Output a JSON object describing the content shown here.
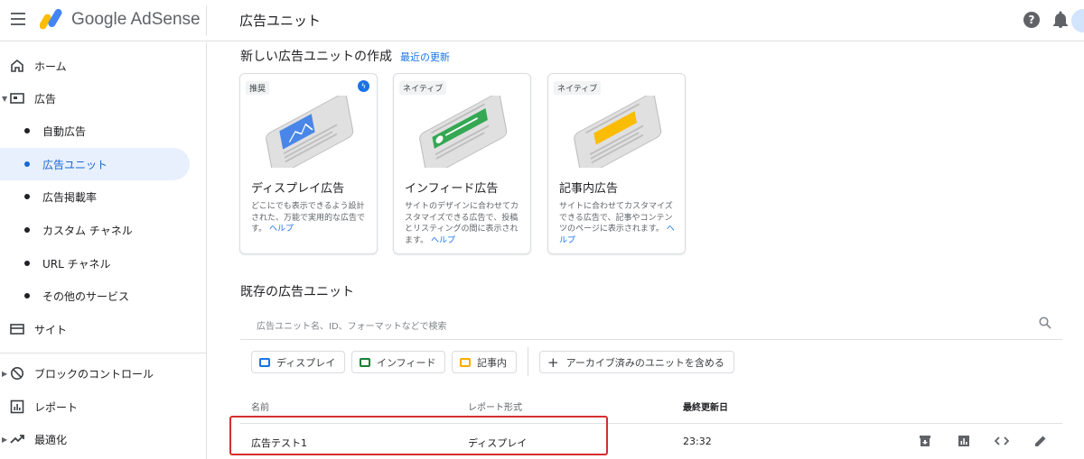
{
  "header": {
    "brand": "Google AdSense",
    "page_title": "広告ユニット",
    "help_glyph": "?"
  },
  "sidebar": {
    "items": [
      {
        "label": "ホーム",
        "icon": "home-icon"
      },
      {
        "label": "広告",
        "icon": "ads-icon"
      },
      {
        "label": "自動広告"
      },
      {
        "label": "広告ユニット"
      },
      {
        "label": "広告掲載率"
      },
      {
        "label": "カスタム チャネル"
      },
      {
        "label": "URL チャネル"
      },
      {
        "label": "その他のサービス"
      },
      {
        "label": "サイト",
        "icon": "site-icon"
      },
      {
        "label": "ブロックのコントロール",
        "icon": "block-icon"
      },
      {
        "label": "レポート",
        "icon": "report-icon"
      },
      {
        "label": "最適化",
        "icon": "optimize-icon"
      }
    ]
  },
  "create": {
    "title": "新しい広告ユニットの作成",
    "recent_link": "最近の更新",
    "cards": [
      {
        "badge": "推奨",
        "title": "ディスプレイ広告",
        "desc": "どこにでも表示できるよう設計された、万能で実用的な広告です。",
        "help": "ヘルプ",
        "accent": "#4a86e8"
      },
      {
        "badge": "ネイティブ",
        "title": "インフィード広告",
        "desc": "サイトのデザインに合わせてカスタマイズできる広告で、投稿とリスティングの間に表示されます。",
        "help": "ヘルプ",
        "accent": "#34a853"
      },
      {
        "badge": "ネイティブ",
        "title": "記事内広告",
        "desc": "サイトに合わせてカスタマイズできる広告で、記事やコンテンツのページに表示されます。",
        "help": "ヘルプ",
        "accent": "#fbbc04"
      }
    ]
  },
  "existing": {
    "title": "既存の広告ユニット",
    "search_placeholder": "広告ユニット名、ID、フォーマットなどで検索",
    "chips": [
      {
        "label": "ディスプレイ",
        "color": "#1a73e8"
      },
      {
        "label": "インフィード",
        "color": "#188038"
      },
      {
        "label": "記事内",
        "color": "#f9ab00"
      }
    ],
    "archive_chip": "アーカイブ済みのユニットを含める",
    "columns": [
      "名前",
      "レポート形式",
      "最終更新日"
    ],
    "rows": [
      {
        "name": "広告テスト1",
        "format": "ディスプレイ",
        "updated": "23:32"
      }
    ]
  }
}
